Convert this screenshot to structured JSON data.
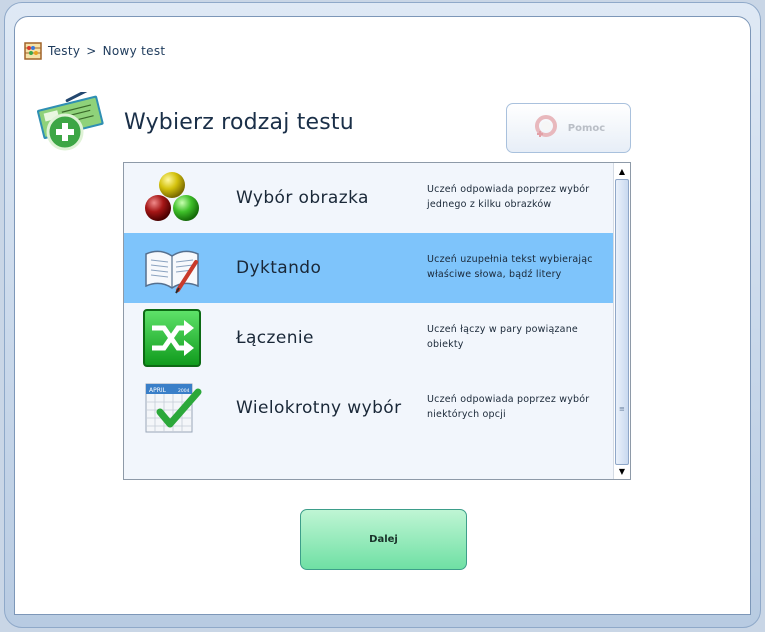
{
  "breadcrumb": {
    "root": "Testy",
    "separator": ">",
    "current": "Nowy test"
  },
  "page": {
    "title": "Wybierz rodzaj testu"
  },
  "help_button": {
    "label": "Pomoc"
  },
  "test_types": [
    {
      "title": "Wybór obrazka",
      "description": "Uczeń odpowiada poprzez wybór jednego z kilku obrazków",
      "icon": "colored-spheres-icon",
      "selected": false
    },
    {
      "title": "Dyktando",
      "description": "Uczeń uzupełnia tekst wybierając właściwe słowa, bądź litery",
      "icon": "open-book-pencil-icon",
      "selected": true
    },
    {
      "title": "Łączenie",
      "description": "Uczeń łączy w pary powiązane obiekty",
      "icon": "shuffle-arrows-icon",
      "selected": false
    },
    {
      "title": "Wielokrotny wybór",
      "description": "Uczeń odpowiada poprzez wybór niektórych opcji",
      "icon": "calendar-check-icon",
      "selected": false,
      "calendar_month": "APRIL",
      "calendar_year": "2004"
    }
  ],
  "next_button": {
    "label": "Dalej"
  },
  "colors": {
    "selected_row": "#7ec4fb",
    "next_button": "#6fe0a4",
    "title_text": "#1a2f48"
  }
}
